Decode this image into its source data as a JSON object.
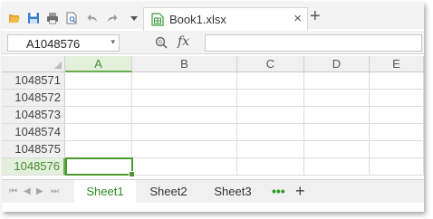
{
  "toolbar": {
    "icons": [
      "open-folder-icon",
      "save-icon",
      "print-icon",
      "print-preview-icon",
      "undo-icon",
      "redo-icon",
      "dropdown-icon"
    ],
    "file_tab": {
      "name": "Book1.xlsx",
      "close": "×",
      "icon": "spreadsheet-file-icon"
    },
    "new_tab": "+"
  },
  "formula_bar": {
    "name_box": "A1048576",
    "name_box_arrow": "▾",
    "fx": "fx",
    "formula": ""
  },
  "grid": {
    "columns": [
      "A",
      "B",
      "C",
      "D",
      "E"
    ],
    "selected_column": "A",
    "rows": [
      "1048571",
      "1048572",
      "1048573",
      "1048574",
      "1048575",
      "1048576"
    ],
    "selected_row": "1048576"
  },
  "sheets": {
    "tabs": [
      "Sheet1",
      "Sheet2",
      "Sheet3"
    ],
    "active": "Sheet1",
    "more": "•••",
    "add": "+",
    "nav": [
      "⏮",
      "◀",
      "▶",
      "⏭"
    ]
  },
  "colors": {
    "accent": "#4a9a30",
    "header_bg": "#f0f0f0",
    "selected_header_bg": "#e3f0dc",
    "active_sheet_text": "#2c8c22"
  }
}
